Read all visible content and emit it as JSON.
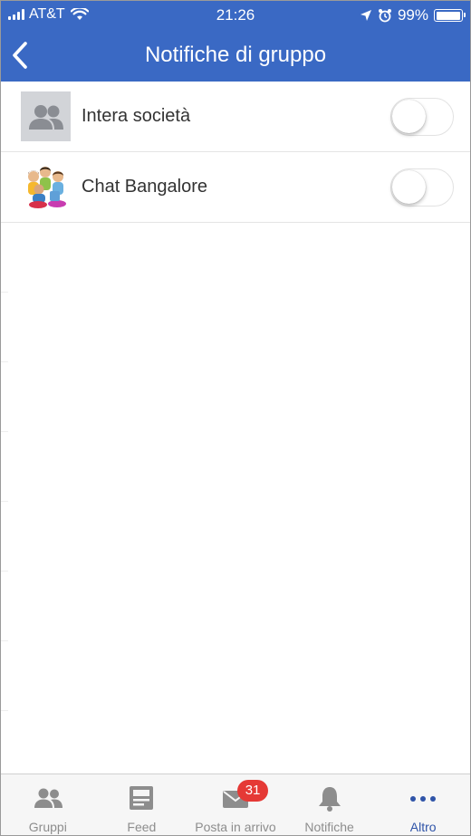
{
  "status_bar": {
    "carrier": "AT&T",
    "time": "21:26",
    "battery": "99%",
    "battery_level": 0.99
  },
  "nav": {
    "title": "Notifiche di gruppo"
  },
  "groups": [
    {
      "name": "Intera società",
      "avatar": "default-group-icon",
      "enabled": false
    },
    {
      "name": "Chat Bangalore",
      "avatar": "group-photo-icon",
      "enabled": false
    }
  ],
  "tabs": [
    {
      "label": "Gruppi",
      "icon": "groups-icon"
    },
    {
      "label": "Feed",
      "icon": "feed-icon"
    },
    {
      "label": "Posta in arrivo",
      "icon": "mail-icon",
      "badge": "31"
    },
    {
      "label": "Notifiche",
      "icon": "bell-icon"
    },
    {
      "label": "Altro",
      "icon": "more-icon",
      "active": true
    }
  ],
  "colors": {
    "brand": "#3a69c4",
    "active_tab": "#2f54a8",
    "badge": "#e53935",
    "inactive_tab": "#8d8d8d"
  }
}
